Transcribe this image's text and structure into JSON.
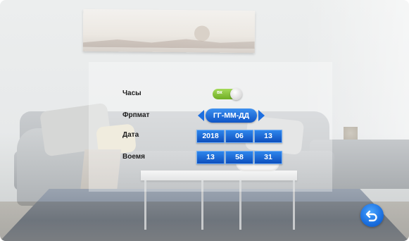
{
  "settings": {
    "clock_label": "Часы",
    "clock_toggle_text": "вк",
    "clock_enabled": true,
    "format_label": "Фрпмат",
    "format_value": "ГГ-ММ-ДД",
    "date_label": "Дата",
    "date_year": "2018",
    "date_month": "06",
    "date_day": "13",
    "time_label": "Воемя",
    "time_hour": "13",
    "time_minute": "58",
    "time_second": "31"
  },
  "icons": {
    "back": "back-arrow-icon",
    "format_prev": "triangle-left-icon",
    "format_next": "triangle-right-icon"
  },
  "colors": {
    "accent_blue": "#1d6fe0",
    "toggle_green": "#8cc63f"
  }
}
